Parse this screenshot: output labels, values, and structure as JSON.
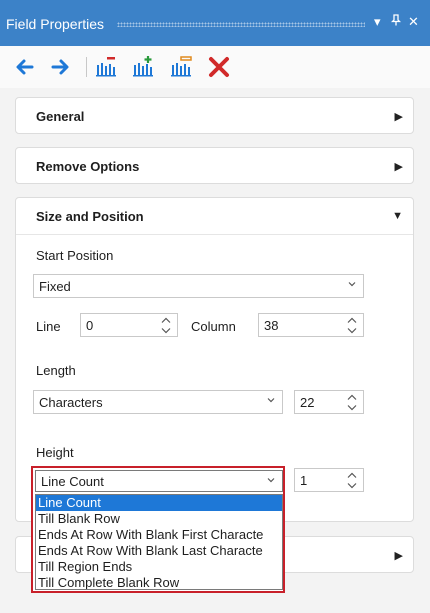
{
  "window": {
    "title": "Field Properties",
    "header_icons": [
      "chevron-down-icon",
      "pin-icon",
      "close-icon"
    ],
    "header_glyphs": [
      "▾",
      "ᵖ",
      "✕"
    ]
  },
  "toolbar": {
    "tools": [
      {
        "name": "back-arrow-icon",
        "color": "#1e78d7"
      },
      {
        "name": "forward-arrow-icon",
        "color": "#1e78d7"
      },
      {
        "name": "remove-field-icon",
        "color": "#1e78d7"
      },
      {
        "name": "add-field-icon",
        "color": "#2a9a3c"
      },
      {
        "name": "insert-field-icon",
        "color": "#1e78d7"
      },
      {
        "name": "delete-icon",
        "color": "#d12a2a"
      }
    ]
  },
  "sections": {
    "general": {
      "label": "General",
      "arrow": "▶"
    },
    "remove_options": {
      "label": "Remove Options",
      "arrow": "▶"
    },
    "size_position": {
      "label": "Size and Position",
      "arrow": "▼"
    },
    "collapsed": {
      "label": "",
      "arrow": "▶"
    }
  },
  "size_position": {
    "start_position": {
      "label": "Start Position",
      "value": "Fixed"
    },
    "line": {
      "label": "Line",
      "value": "0"
    },
    "column": {
      "label": "Column",
      "value": "38"
    },
    "length": {
      "label": "Length",
      "value": "Characters",
      "count": "22"
    },
    "height": {
      "label": "Height",
      "value": "Line Count",
      "count": "1",
      "options": [
        "Line Count",
        "Till Blank Row",
        "Ends At Row With Blank First Characte",
        "Ends At Row With Blank Last Characte",
        "Till Region Ends",
        "Till Complete Blank Row"
      ],
      "selected_index": 0
    }
  },
  "colors": {
    "titlebar": "#3c82c8",
    "selection": "#1e78d7",
    "highlight_border": "#c8202a"
  }
}
